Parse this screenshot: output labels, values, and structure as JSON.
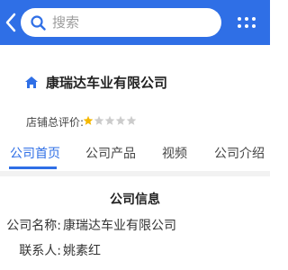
{
  "search": {
    "placeholder": "搜索"
  },
  "company": {
    "name": "康瑞达车业有限公司"
  },
  "rating": {
    "label": "店铺总评价:",
    "value": 1,
    "max": 5
  },
  "tabs": [
    {
      "label": "公司首页",
      "active": true
    },
    {
      "label": "公司产品",
      "active": false
    },
    {
      "label": "视频",
      "active": false
    },
    {
      "label": "公司介绍",
      "active": false
    }
  ],
  "info": {
    "title": "公司信息",
    "rows": [
      {
        "label": "公司名称:",
        "value": "康瑞达车业有限公司"
      },
      {
        "label": "联系人:",
        "value": "姚素红"
      }
    ]
  },
  "colors": {
    "accent": "#2f6fe6",
    "star_on": "#f5b800",
    "star_off": "#cccccc"
  },
  "icons": [
    "back-arrow-icon",
    "search-icon",
    "menu-dots-icon",
    "home-icon",
    "star-icon"
  ]
}
